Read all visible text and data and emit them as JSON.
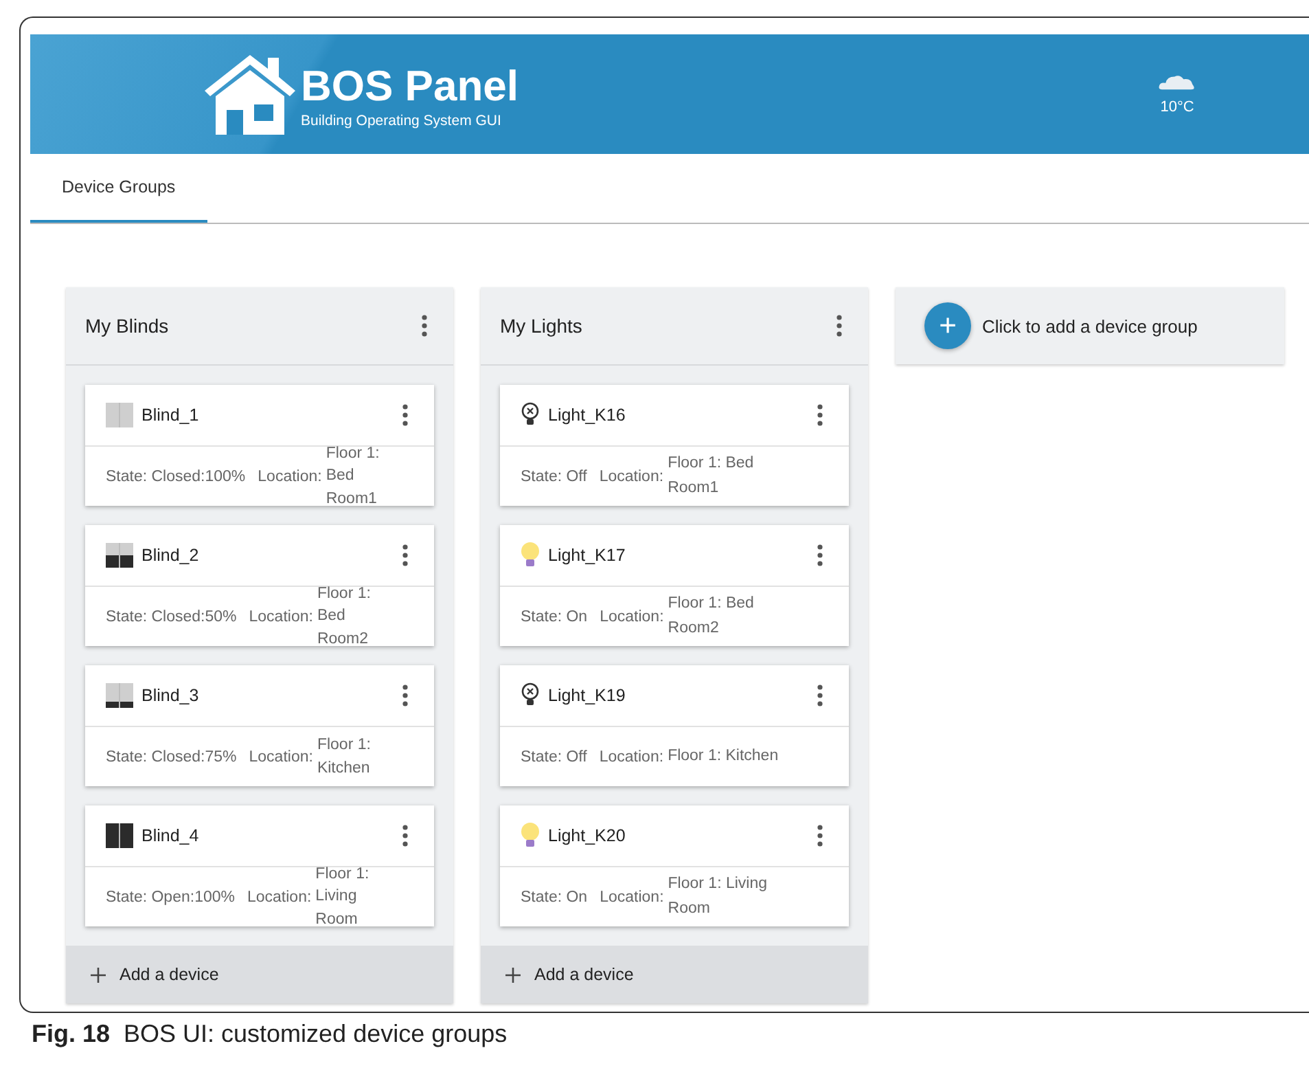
{
  "header": {
    "title": "BOS Panel",
    "subtitle": "Building Operating System GUI",
    "temperature": "10°C"
  },
  "tabs": [
    {
      "label": "Device Groups",
      "selected": true
    }
  ],
  "groups": [
    {
      "title": "My Blinds",
      "add_label": "Add a device",
      "devices": [
        {
          "kind": "blind",
          "name": "Blind_1",
          "state": "State: Closed:100%",
          "location_label": "Location:",
          "location": "Floor 1: Bed Room1"
        },
        {
          "kind": "blind",
          "name": "Blind_2",
          "state": "State: Closed:50%",
          "location_label": "Location:",
          "location": "Floor 1: Bed Room2"
        },
        {
          "kind": "blind",
          "name": "Blind_3",
          "state": "State: Closed:75%",
          "location_label": "Location:",
          "location": "Floor 1: Kitchen"
        },
        {
          "kind": "blind",
          "name": "Blind_4",
          "state": "State: Open:100%",
          "location_label": "Location:",
          "location": "Floor 1: Living Room"
        }
      ]
    },
    {
      "title": "My Lights",
      "add_label": "Add a device",
      "devices": [
        {
          "kind": "light",
          "name": "Light_K16",
          "state": "State: Off",
          "location_label": "Location:",
          "location": "Floor 1: Bed Room1",
          "on": false
        },
        {
          "kind": "light",
          "name": "Light_K17",
          "state": "State: On",
          "location_label": "Location:",
          "location": "Floor 1: Bed Room2",
          "on": true
        },
        {
          "kind": "light",
          "name": "Light_K19",
          "state": "State: Off",
          "location_label": "Location:",
          "location": "Floor 1: Kitchen",
          "on": false
        },
        {
          "kind": "light",
          "name": "Light_K20",
          "state": "State: On",
          "location_label": "Location:",
          "location": "Floor 1: Living Room",
          "on": true
        }
      ]
    }
  ],
  "add_group": {
    "icon": "+",
    "label": "Click to add a device group"
  },
  "caption": {
    "number": "Fig. 18",
    "text": "BOS UI: customized device groups"
  }
}
